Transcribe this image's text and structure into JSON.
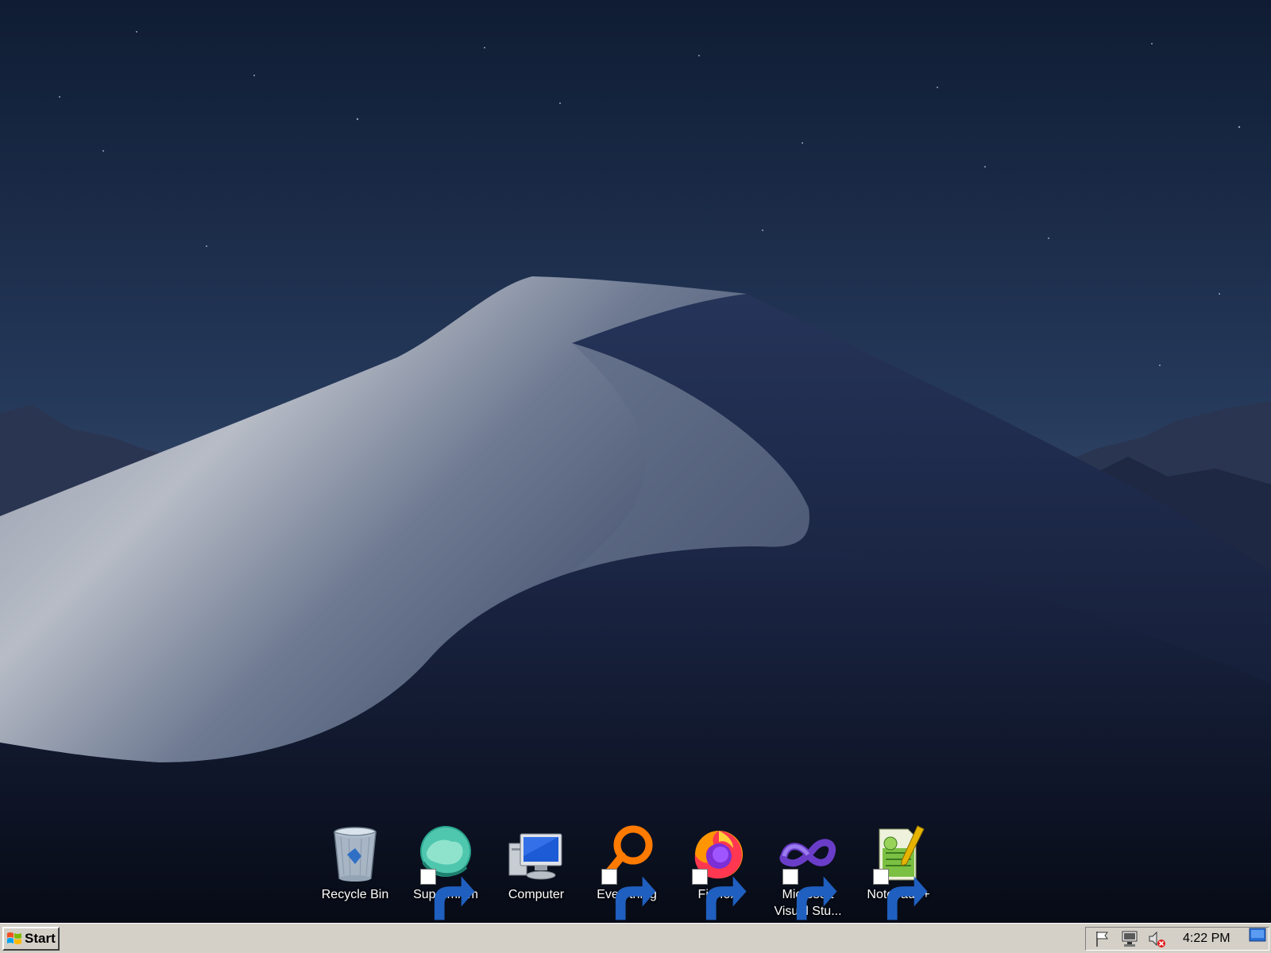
{
  "desktop": {
    "icons": [
      {
        "label": "Recycle Bin",
        "icon": "recycle-bin-icon",
        "shortcut": false
      },
      {
        "label": "Supermium",
        "icon": "supermium-icon",
        "shortcut": true
      },
      {
        "label": "Computer",
        "icon": "computer-icon",
        "shortcut": false
      },
      {
        "label": "Everything",
        "icon": "everything-icon",
        "shortcut": true
      },
      {
        "label": "Firefox",
        "icon": "firefox-icon",
        "shortcut": true
      },
      {
        "label": "Microsoft\nVisual Stu...",
        "icon": "visual-studio-icon",
        "shortcut": true
      },
      {
        "label": "Notepad++",
        "icon": "notepad-plus-plus-icon",
        "shortcut": true
      }
    ]
  },
  "taskbar": {
    "start_label": "Start",
    "clock": "4:22 PM",
    "tray_icons": [
      "action-center-flag-icon",
      "network-icon",
      "volume-muted-icon"
    ]
  },
  "colors": {
    "taskbar": "#d4d0c8",
    "sky_top": "#0f1c33",
    "sky_bottom": "#3a4d6e",
    "dune_light": "#c9ccd3",
    "dune_dark": "#111a30"
  }
}
